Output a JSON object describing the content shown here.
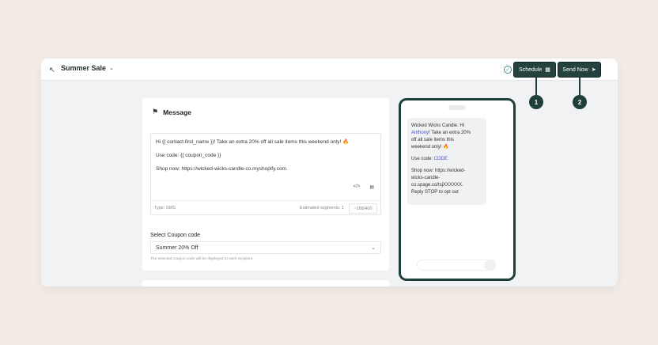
{
  "header": {
    "title": "Summer Sale",
    "back_icon": "↖",
    "dropdown_icon": "⌄",
    "status_icon": "✓",
    "schedule_label": "Schedule",
    "schedule_icon": "▦",
    "send_label": "Send Now",
    "send_icon": "➤",
    "accent_color": "#24433f"
  },
  "markers": [
    "1",
    "2"
  ],
  "message": {
    "heading": "Message",
    "heading_icon": "⚑",
    "lines": [
      "Hi {{ contact.first_name }}! Take an extra 20% off all sale items this weekend only!",
      "Use code: {{ coupon_code }}",
      "Shop now: https://wicked-wicks-candle-co.myshopify.com."
    ],
    "emoji": "🔥",
    "tool_code_icon": "</>",
    "tool_media_icon": "▤",
    "type_label": "Type: SMS",
    "segments_label": "Estimated segments: 1",
    "char_count": "~188/400"
  },
  "coupon": {
    "label": "Select Coupon code",
    "selected": "Summer 20% Off",
    "chevron": "⌄",
    "help": "The selected coupon code will be displayed to each recipient."
  },
  "preview": {
    "line1": "Wicked Wicks Candle: Hi",
    "line2_name": "Anthony",
    "line2_rest": "! Take an extra 20%",
    "line3": "off all sale items this",
    "line4": "weekend only!",
    "emoji": "🔥",
    "code_label": "Use code: ",
    "code_value": "CODE",
    "shop1": "Shop now: https://wicked-",
    "shop2": "wicks-candle-",
    "shop3": "co.spage.co/tsjXXXXXX.",
    "stop": "Reply STOP to opt out"
  }
}
